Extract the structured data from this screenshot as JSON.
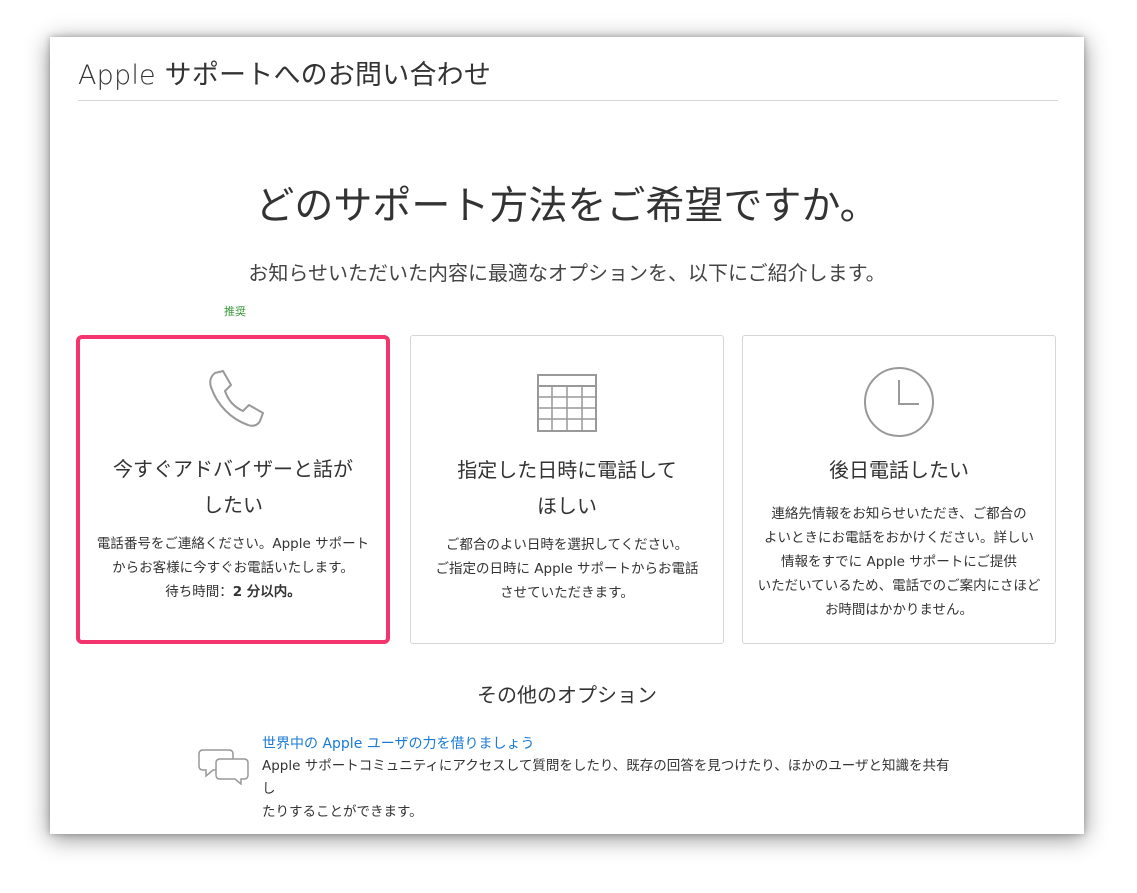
{
  "header": {
    "title": "Apple サポートへのお問い合わせ"
  },
  "hero": {
    "title": "どのサポート方法をご希望ですか。",
    "subtitle": "お知らせいただいた内容に最適なオプションを、以下にご紹介します。"
  },
  "recommended_label": "推奨",
  "cards": [
    {
      "icon": "phone-icon",
      "title_line1": "今すぐアドバイザーと話が",
      "title_line2": "したい",
      "desc_line1": "電話番号をご連絡ください。Apple サポート",
      "desc_line2": "からお客様に今すぐお電話いたします。",
      "wait_label": "待ち時間：",
      "wait_value": "2 分以内。",
      "selected": true
    },
    {
      "icon": "calendar-icon",
      "title_line1": "指定した日時に電話して",
      "title_line2": "ほしい",
      "desc_line1": "ご都合のよい日時を選択してください。",
      "desc_line2": "ご指定の日時に Apple サポートからお電話",
      "desc_line3": "させていただきます。"
    },
    {
      "icon": "clock-icon",
      "title_line1": "後日電話したい",
      "desc_line1": "連絡先情報をお知らせいただき、ご都合の",
      "desc_line2": "よいときにお電話をおかけください。詳しい",
      "desc_line3": "情報をすでに Apple サポートにご提供",
      "desc_line4": "いただいているため、電話でのご案内にさほど",
      "desc_line5": "お時間はかかりません。"
    }
  ],
  "other": {
    "title": "その他のオプション",
    "community_icon": "chat-bubbles-icon",
    "community_link": "世界中の Apple ユーザの力を借りましょう",
    "community_desc_line1": "Apple サポートコミュニティにアクセスして質問をしたり、既存の回答を見つけたり、ほかのユーザと知識を共有し",
    "community_desc_line2": "たりすることができます。"
  },
  "colors": {
    "selected_border": "#f4346c",
    "recommended": "#3a9b3a",
    "link": "#1a7bd4",
    "icon_stroke": "#999999"
  }
}
